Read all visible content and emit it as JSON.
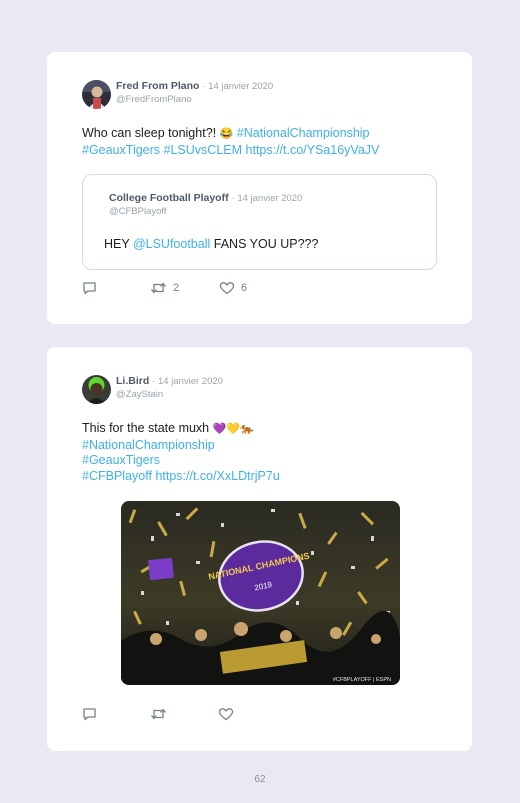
{
  "tweets": [
    {
      "name": "Fred From Plano",
      "date": "· 14 janvier 2020",
      "handle": "@FredFromPlano",
      "text_start": "Who can sleep tonight?! ",
      "emoji": "😂",
      "hashtag_national": "#NationalChampionship",
      "hashtag_geaux": "#GeauxTigers",
      "hashtag_lsuvsclem": "#LSUvsCLEM",
      "link": "https://t.co/YSa16yVaJV",
      "quote": {
        "name": "College Football Playoff",
        "date": "· 14 janvier 2020",
        "handle": "@CFBPlayoff",
        "text_start": "HEY ",
        "mention": "@LSUfootball",
        "text_end": " FANS YOU UP???"
      },
      "actions": {
        "retweet_count": "2",
        "like_count": "6"
      }
    },
    {
      "name": "Li.Bird",
      "date": "· 14 janvier 2020",
      "handle": "@ZayStain",
      "text_start": "This for the state muxh ",
      "emoji": "💜💛🐅",
      "hashtag_national": "#NationalChampionship",
      "hashtag_geaux": "#GeauxTigers",
      "hashtag_cfb": "#CFBPlayoff",
      "link": "https://t.co/XxLDtrjP7u",
      "media": {
        "banner_text": "NATIONAL CHAMPIONS",
        "year": "2019",
        "watermark": "#CFBPLAYOFF | ESPN"
      }
    }
  ],
  "page_number": "62",
  "colors": {
    "background": "#ebe7f3",
    "card": "#ffffff",
    "link": "#3cb1ec",
    "name": "#4e5a6a",
    "meta": "#9aa3ad",
    "icon": "#75808b"
  },
  "icons": [
    "reply-icon",
    "retweet-icon",
    "like-icon"
  ]
}
